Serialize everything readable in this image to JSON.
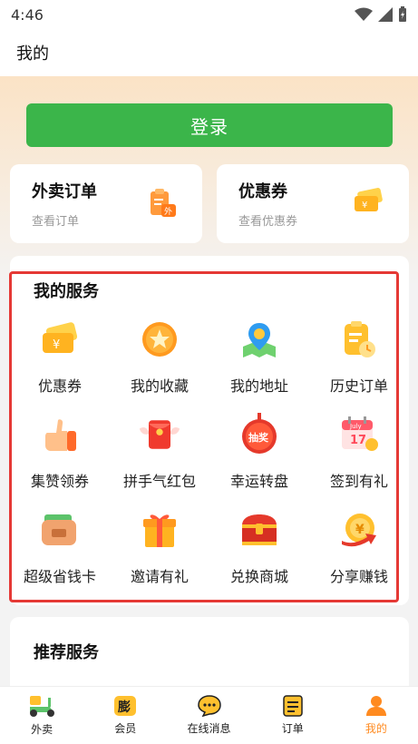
{
  "status_bar": {
    "time": "4:46"
  },
  "header": {
    "title": "我的"
  },
  "login": {
    "label": "登录"
  },
  "quick_cards": [
    {
      "title": "外卖订单",
      "subtitle": "查看订单",
      "icon": "takeout-order-icon"
    },
    {
      "title": "优惠券",
      "subtitle": "查看优惠券",
      "icon": "coupon-icon"
    }
  ],
  "services": {
    "title": "我的服务",
    "items": [
      {
        "label": "优惠券",
        "icon": "coupon-icon"
      },
      {
        "label": "我的收藏",
        "icon": "star-icon"
      },
      {
        "label": "我的地址",
        "icon": "map-pin-icon"
      },
      {
        "label": "历史订单",
        "icon": "history-order-icon"
      },
      {
        "label": "集赞领券",
        "icon": "thumbs-up-icon"
      },
      {
        "label": "拼手气红包",
        "icon": "red-envelope-icon"
      },
      {
        "label": "幸运转盘",
        "icon": "lucky-wheel-icon",
        "badge": "抽奖"
      },
      {
        "label": "签到有礼",
        "icon": "calendar-icon",
        "badge_month": "July",
        "badge_day": "17"
      },
      {
        "label": "超级省钱卡",
        "icon": "wallet-icon"
      },
      {
        "label": "邀请有礼",
        "icon": "gift-icon"
      },
      {
        "label": "兑换商城",
        "icon": "treasure-chest-icon"
      },
      {
        "label": "分享赚钱",
        "icon": "coin-share-icon"
      }
    ]
  },
  "recommend": {
    "title": "推荐服务"
  },
  "bottom_nav": [
    {
      "label": "外卖",
      "icon": "scooter-icon",
      "active": false
    },
    {
      "label": "会员",
      "icon": "vip-icon",
      "badge": "膨",
      "active": false
    },
    {
      "label": "在线消息",
      "icon": "chat-icon",
      "active": false
    },
    {
      "label": "订单",
      "icon": "order-list-icon",
      "active": false
    },
    {
      "label": "我的",
      "icon": "user-icon",
      "active": true
    }
  ],
  "colors": {
    "accent": "#3bb54a",
    "orange": "#ff8a1f",
    "highlight_frame": "#e53935"
  }
}
